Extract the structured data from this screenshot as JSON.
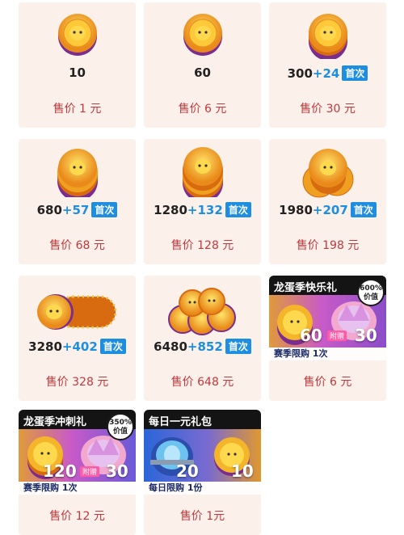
{
  "colors": {
    "card_bg": "#fbf0ea",
    "price_red": "#c4383c",
    "bonus_blue": "#1e8fe0",
    "pack_purple": "#8a4ec9",
    "pack_blue": "#2a66d9"
  },
  "coins": [
    {
      "amount": "10",
      "bonus": "",
      "first": "",
      "price": "售价 1 元",
      "icon": "single-coin-icon"
    },
    {
      "amount": "60",
      "bonus": "",
      "first": "",
      "price": "售价 6 元",
      "icon": "single-coin-icon"
    },
    {
      "amount": "300",
      "bonus": "+24",
      "first": "首次",
      "price": "售价 30 元",
      "icon": "coin-stack-icon"
    },
    {
      "amount": "680",
      "bonus": "+57",
      "first": "首次",
      "price": "售价 68 元",
      "icon": "coin-stack-icon"
    },
    {
      "amount": "1280",
      "bonus": "+132",
      "first": "首次",
      "price": "售价 128 元",
      "icon": "coin-stack-icon"
    },
    {
      "amount": "1980",
      "bonus": "+207",
      "first": "首次",
      "price": "售价 198 元",
      "icon": "coin-pile-icon"
    },
    {
      "amount": "3280",
      "bonus": "+402",
      "first": "首次",
      "price": "售价 328 元",
      "icon": "coin-row-icon"
    },
    {
      "amount": "6480",
      "bonus": "+852",
      "first": "首次",
      "price": "售价 648 元",
      "icon": "coin-heap-icon"
    }
  ],
  "packs": [
    {
      "title": "龙蛋季快乐礼",
      "badge_pct": "600%",
      "badge_word": "价值",
      "main": "60",
      "gift": "附赠",
      "extra": "30",
      "limit": "赛季限购 1次",
      "price": "售价 6 元"
    },
    {
      "title": "龙蛋季冲刺礼",
      "badge_pct": "350%",
      "badge_word": "价值",
      "main": "120",
      "gift": "附赠",
      "extra": "30",
      "limit": "赛季限购 1次",
      "price": "售价 12 元"
    },
    {
      "title": "每日一元礼包",
      "badge_pct": "",
      "badge_word": "",
      "main": "20",
      "gift": "",
      "extra": "10",
      "limit": "每日限购 1份",
      "price": "售价 1元"
    }
  ]
}
